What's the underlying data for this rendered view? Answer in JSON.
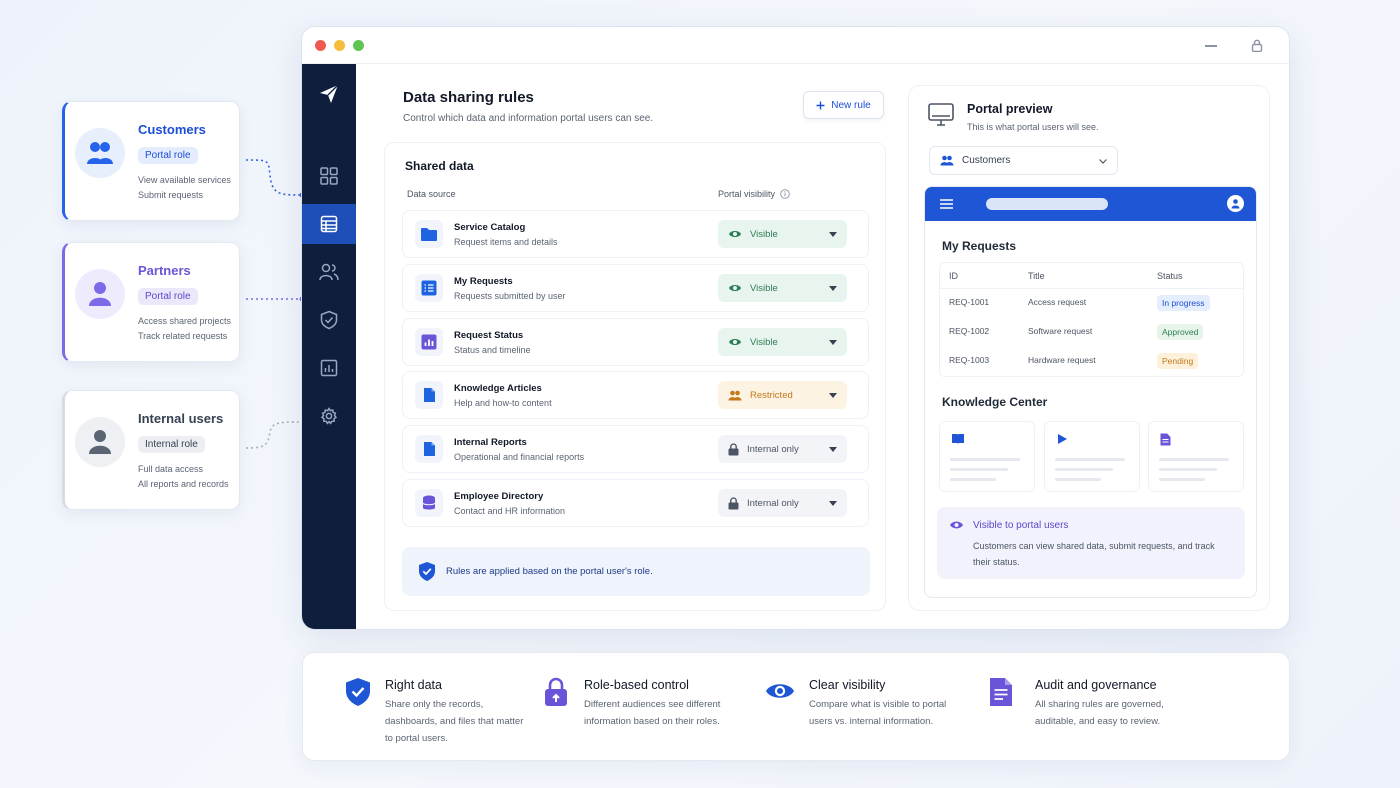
{
  "roles": [
    {
      "title": "Customers",
      "badge": "Portal role",
      "line1": "View available services",
      "line2": "Submit requests"
    },
    {
      "title": "Partners",
      "badge": "Portal role",
      "line1": "Access shared projects",
      "line2": "Track related requests"
    },
    {
      "title": "Internal users",
      "badge": "Internal role",
      "line1": "Full data access",
      "line2": "All reports and records"
    }
  ],
  "header": {
    "title": "Data sharing rules",
    "subtitle": "Control which data and information portal users can see.",
    "new_rule_label": "New rule"
  },
  "shared": {
    "title": "Shared data",
    "col_source": "Data source",
    "col_visibility": "Portal visibility",
    "rows": [
      {
        "name": "Service Catalog",
        "desc": "Request items and details",
        "visibility": "Visible"
      },
      {
        "name": "My Requests",
        "desc": "Requests submitted by user",
        "visibility": "Visible"
      },
      {
        "name": "Request Status",
        "desc": "Status and timeline",
        "visibility": "Visible"
      },
      {
        "name": "Knowledge Articles",
        "desc": "Help and how-to content",
        "visibility": "Restricted"
      },
      {
        "name": "Internal Reports",
        "desc": "Operational and financial reports",
        "visibility": "Internal only"
      },
      {
        "name": "Employee Directory",
        "desc": "Contact and HR information",
        "visibility": "Internal only"
      }
    ],
    "note": "Rules are applied based on the portal user's role."
  },
  "preview": {
    "title": "Portal preview",
    "subtitle": "This is what portal users will see.",
    "selected_role": "Customers",
    "requests_title": "My Requests",
    "table_headers": [
      "ID",
      "Title",
      "Status"
    ],
    "requests": [
      {
        "id": "REQ-1001",
        "title": "Access request",
        "status": "In progress"
      },
      {
        "id": "REQ-1002",
        "title": "Software request",
        "status": "Approved"
      },
      {
        "id": "REQ-1003",
        "title": "Hardware request",
        "status": "Pending"
      }
    ],
    "knowledge_title": "Knowledge Center",
    "visible_title": "Visible to portal users",
    "visible_desc": "Customers can view shared data, submit requests, and track their status."
  },
  "features": [
    {
      "title": "Right data",
      "desc": "Share only the records, dashboards, and files that matter to portal users."
    },
    {
      "title": "Role-based control",
      "desc": "Different audiences see different information based on their roles."
    },
    {
      "title": "Clear visibility",
      "desc": "Compare what is visible to portal users vs. internal information."
    },
    {
      "title": "Audit and governance",
      "desc": "All sharing rules are governed, auditable, and easy to review."
    }
  ],
  "colors": {
    "accent": "#1e56d6",
    "sidebar": "#0f1e3d",
    "visible": "#2f7d55",
    "restricted": "#c4781a",
    "purple": "#6a55d8"
  }
}
